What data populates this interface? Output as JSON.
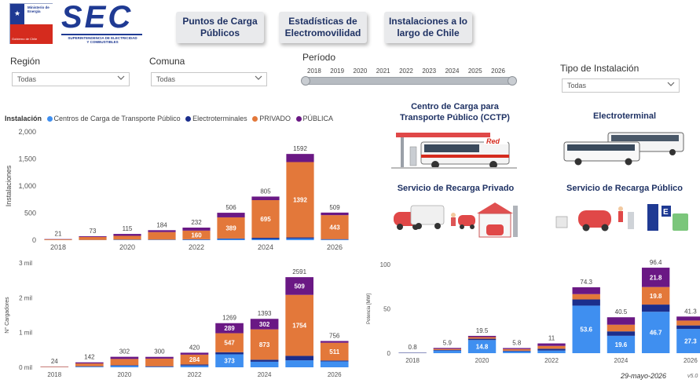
{
  "logo": {
    "ministerio_line1": "Ministerio de",
    "ministerio_line2": "Energía",
    "gobierno": "Gobierno de Chile",
    "brand": "SEC",
    "brand_sub1": "SUPERINTENDENCIA DE ELECTRICIDAD",
    "brand_sub2": "Y COMBUSTIBLES"
  },
  "nav": {
    "puntos_line1": "Puntos de Carga",
    "puntos_line2": "Públicos",
    "estadisticas_line1": "Estadísticas de",
    "estadisticas_line2": "Electromovilidad",
    "instalaciones_line1": "Instalaciones a lo",
    "instalaciones_line2": "largo de Chile"
  },
  "filters": {
    "region_label": "Región",
    "region_value": "Todas",
    "comuna_label": "Comuna",
    "comuna_value": "Todas",
    "periodo_label": "Período",
    "years": [
      "2018",
      "2019",
      "2020",
      "2021",
      "2022",
      "2023",
      "2024",
      "2025",
      "2026"
    ],
    "tipo_label": "Tipo de Instalación",
    "tipo_value": "Todas"
  },
  "legend": {
    "title": "Instalación",
    "items": [
      {
        "name": "Centros de Carga de Transporte Público",
        "color": "#3f8ff0"
      },
      {
        "name": "Electroterminales",
        "color": "#1b2e8c"
      },
      {
        "name": "PRIVADO",
        "color": "#e3783a"
      },
      {
        "name": "PÚBLICA",
        "color": "#6a1884"
      }
    ]
  },
  "cards": {
    "cctp_line1": "Centro de Carga para",
    "cctp_line2": "Transporte Público (CCTP)",
    "electroterminal": "Electroterminal",
    "privado": "Servicio de Recarga Privado",
    "publico": "Servicio de Recarga Público",
    "red_sign": "Red"
  },
  "footer": {
    "date": "29-mayo-2026",
    "version": "v5.0"
  },
  "colors": {
    "ccp": "#3f8ff0",
    "electro": "#1b2e8c",
    "privado": "#e3783a",
    "publica": "#6a1884",
    "nav_text": "#1f3264"
  },
  "chart_data": [
    {
      "type": "bar",
      "stacked": true,
      "ylabel": "Instalaciones",
      "ylim": [
        0,
        2000
      ],
      "yticks": [
        "0",
        "500",
        "1,000",
        "1,500",
        "2,000"
      ],
      "ytick_values": [
        0,
        500,
        1000,
        1500,
        2000
      ],
      "x": [
        "2018",
        "2019",
        "2020",
        "2021",
        "2022",
        "2023",
        "2024",
        "2025",
        "2026"
      ],
      "xtick_labels": [
        "2018",
        "2020",
        "2022",
        "2024",
        "2026"
      ],
      "totals": [
        21,
        73,
        115,
        184,
        232,
        506,
        805,
        1592,
        509
      ],
      "series": [
        {
          "name": "Centros de Carga de Transporte Público",
          "values": [
            1,
            2,
            6,
            6,
            10,
            22,
            22,
            30,
            12
          ]
        },
        {
          "name": "Electroterminales",
          "values": [
            1,
            2,
            4,
            4,
            6,
            10,
            22,
            20,
            7
          ]
        },
        {
          "name": "PRIVADO",
          "values": [
            14,
            55,
            70,
            140,
            160,
            389,
            695,
            1392,
            443
          ]
        },
        {
          "name": "PÚBLICA",
          "values": [
            5,
            14,
            35,
            34,
            56,
            85,
            66,
            150,
            47
          ]
        }
      ],
      "segment_labels": [
        {
          "i": 4,
          "series": 2,
          "text": "160"
        },
        {
          "i": 5,
          "series": 2,
          "text": "389"
        },
        {
          "i": 6,
          "series": 2,
          "text": "695"
        },
        {
          "i": 7,
          "series": 2,
          "text": "1392"
        },
        {
          "i": 8,
          "series": 2,
          "text": "443"
        }
      ]
    },
    {
      "type": "bar",
      "stacked": true,
      "ylabel": "N° Cargadores",
      "ylim": [
        0,
        3000
      ],
      "yticks": [
        "0 mil",
        "1 mil",
        "2 mil",
        "3 mil"
      ],
      "ytick_values": [
        0,
        1000,
        2000,
        3000
      ],
      "x": [
        "2018",
        "2019",
        "2020",
        "2021",
        "2022",
        "2023",
        "2024",
        "2025",
        "2026"
      ],
      "xtick_labels": [
        "2018",
        "2020",
        "2022",
        "2024",
        "2026"
      ],
      "totals": [
        24,
        142,
        302,
        300,
        420,
        1269,
        1393,
        2591,
        756
      ],
      "series": [
        {
          "name": "Centros de Carga de Transporte Público",
          "values": [
            2,
            20,
            45,
            15,
            50,
            373,
            160,
            200,
            170
          ]
        },
        {
          "name": "Electroterminales",
          "values": [
            2,
            10,
            15,
            15,
            30,
            60,
            58,
            128,
            25
          ]
        },
        {
          "name": "PRIVADO",
          "values": [
            15,
            80,
            180,
            220,
            284,
            547,
            873,
            1754,
            511
          ]
        },
        {
          "name": "PÚBLICA",
          "values": [
            5,
            32,
            62,
            50,
            56,
            289,
            302,
            509,
            50
          ]
        }
      ],
      "segment_labels": [
        {
          "i": 4,
          "series": 2,
          "text": "284"
        },
        {
          "i": 5,
          "series": 0,
          "text": "373"
        },
        {
          "i": 5,
          "series": 2,
          "text": "547"
        },
        {
          "i": 5,
          "series": 3,
          "text": "289"
        },
        {
          "i": 6,
          "series": 2,
          "text": "873"
        },
        {
          "i": 6,
          "series": 3,
          "text": "302"
        },
        {
          "i": 7,
          "series": 2,
          "text": "1754"
        },
        {
          "i": 7,
          "series": 3,
          "text": "509"
        },
        {
          "i": 8,
          "series": 2,
          "text": "511"
        }
      ]
    },
    {
      "type": "bar",
      "stacked": true,
      "ylabel": "Potencia [MW]",
      "ylim": [
        0,
        100
      ],
      "yticks": [
        "0",
        "50",
        "100"
      ],
      "ytick_values": [
        0,
        50,
        100
      ],
      "x": [
        "2018",
        "2019",
        "2020",
        "2021",
        "2022",
        "2023",
        "2024",
        "2025",
        "2026"
      ],
      "xtick_labels": [
        "2018",
        "2020",
        "2022",
        "2024",
        "2026"
      ],
      "totals": [
        0.8,
        5.9,
        19.5,
        5.8,
        11.0,
        74.3,
        40.5,
        96.4,
        41.3
      ],
      "series": [
        {
          "name": "Centros de Carga de Transporte Público",
          "values": [
            0.4,
            3.0,
            14.8,
            2.0,
            3.0,
            53.6,
            19.6,
            46.7,
            27.3
          ]
        },
        {
          "name": "Electroterminales",
          "values": [
            0.1,
            0.6,
            1.5,
            0.8,
            2.0,
            7.0,
            5.0,
            8.1,
            4.0
          ]
        },
        {
          "name": "PRIVADO",
          "values": [
            0.2,
            1.2,
            1.8,
            1.8,
            3.2,
            6.0,
            7.5,
            19.8,
            5.5
          ]
        },
        {
          "name": "PÚBLICA",
          "values": [
            0.1,
            1.1,
            1.4,
            1.2,
            2.8,
            7.7,
            8.4,
            21.8,
            4.5
          ]
        }
      ],
      "segment_labels": [
        {
          "i": 2,
          "series": 0,
          "text": "14.8"
        },
        {
          "i": 5,
          "series": 0,
          "text": "53.6"
        },
        {
          "i": 6,
          "series": 0,
          "text": "19.6"
        },
        {
          "i": 7,
          "series": 0,
          "text": "46.7"
        },
        {
          "i": 7,
          "series": 2,
          "text": "19.8"
        },
        {
          "i": 7,
          "series": 3,
          "text": "21.8"
        },
        {
          "i": 8,
          "series": 0,
          "text": "27.3"
        }
      ]
    }
  ]
}
